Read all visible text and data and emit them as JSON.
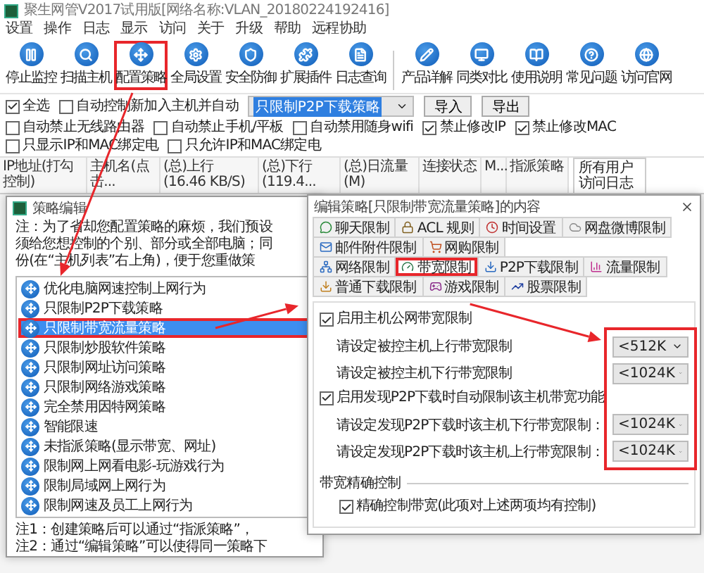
{
  "window": {
    "title": "聚生网管V2017试用版[网络名称:VLAN_20180224192416]"
  },
  "menu": [
    "设置",
    "操作",
    "日志",
    "显示",
    "访问",
    "关于",
    "升级",
    "帮助",
    "远程协助"
  ],
  "toolbar_groups": [
    {
      "buttons": [
        {
          "label": "停止监控",
          "highlighted": false
        },
        {
          "label": "扫描主机",
          "highlighted": false
        },
        {
          "label": "配置策略",
          "highlighted": true
        },
        {
          "label": "全局设置",
          "highlighted": false
        },
        {
          "label": "安全防御",
          "highlighted": false
        },
        {
          "label": "扩展插件",
          "highlighted": false
        },
        {
          "label": "日志查询",
          "highlighted": false
        }
      ]
    },
    {
      "buttons": [
        {
          "label": "产品详解",
          "highlighted": false
        },
        {
          "label": "同类对比",
          "highlighted": false
        },
        {
          "label": "使用说明",
          "highlighted": false
        },
        {
          "label": "常见问题",
          "highlighted": false
        },
        {
          "label": "访问官网",
          "highlighted": false
        }
      ]
    }
  ],
  "options": {
    "select_all": {
      "label": "全选",
      "checked": true
    },
    "auto_control": {
      "label": "自动控制新加入主机并自动",
      "checked": false
    },
    "strategy_select": {
      "value": "只限制P2P下载策略"
    },
    "buttons": [
      "导入",
      "导出"
    ]
  },
  "restrictions": [
    {
      "label": "自动禁止无线路由器",
      "checked": false
    },
    {
      "label": "自动禁止手机/平板",
      "checked": false
    },
    {
      "label": "自动禁用随身wifi",
      "checked": false
    },
    {
      "label": "禁止修改IP",
      "checked": true
    },
    {
      "label": "禁止修改MAC",
      "checked": true
    },
    {
      "label": "只显示IP和MAC绑定电",
      "checked": false
    },
    {
      "label": "只允许IP和MAC绑定电",
      "checked": false
    }
  ],
  "table": {
    "columns": [
      "IP地址(打勾控制)",
      "主机名(点击...",
      "(总)上行(16.46 KB/S)",
      "(总)下行(119.4...",
      "(总)日流量(M)",
      "连接状态",
      "M...",
      "指派策略"
    ],
    "tabs": [
      {
        "label": "所有用户访问日志",
        "selected": true
      }
    ]
  },
  "strategy_editor": {
    "title": "策略编辑",
    "notes": [
      "注：为了省却您配置策略的麻烦，我们预设",
      "须给您想控制的个别、部分或全部电脑；同",
      "份(在“主机列表”右上角)，便于您重做策"
    ],
    "strategies": [
      {
        "label": "优化电脑网速控制上网行为",
        "selected": false,
        "highlighted": false
      },
      {
        "label": "只限制P2P下载策略",
        "selected": false,
        "highlighted": false
      },
      {
        "label": "只限制带宽流量策略",
        "selected": true,
        "highlighted": true
      },
      {
        "label": "只限制炒股软件策略",
        "selected": false,
        "highlighted": false
      },
      {
        "label": "只限制网址访问策略",
        "selected": false,
        "highlighted": false
      },
      {
        "label": "只限制网络游戏策略",
        "selected": false,
        "highlighted": false
      },
      {
        "label": "完全禁用因特网策略",
        "selected": false,
        "highlighted": false
      },
      {
        "label": "智能限速",
        "selected": false,
        "highlighted": false
      },
      {
        "label": "未指派策略(显示带宽、网址)",
        "selected": false,
        "highlighted": false
      },
      {
        "label": "限制网上网看电影-玩游戏行为",
        "selected": false,
        "highlighted": false
      },
      {
        "label": "限制局域网上网行为",
        "selected": false,
        "highlighted": false
      },
      {
        "label": "限制网速及员工上网行为",
        "selected": false,
        "highlighted": false
      }
    ],
    "footnotes": [
      "注1：创建策略后可以通过“指派策略”，",
      "注2：通过“编辑策略”可以使得同一策略下"
    ]
  },
  "content_editor": {
    "title": "编辑策略[只限制带宽流量策略]的内容",
    "tab_rows": [
      [
        {
          "label": "聊天限制",
          "selected": false,
          "highlighted": false
        },
        {
          "label": "ACL 规则",
          "selected": false,
          "highlighted": false
        },
        {
          "label": "时间设置",
          "selected": false,
          "highlighted": false
        },
        {
          "label": "网盘微博限制",
          "selected": false,
          "highlighted": false
        },
        {
          "label": "邮件附件限制",
          "selected": false,
          "highlighted": false
        },
        {
          "label": "网购限制",
          "selected": false,
          "highlighted": false
        }
      ],
      [
        {
          "label": "网络限制",
          "selected": false,
          "highlighted": false
        },
        {
          "label": "带宽限制",
          "selected": true,
          "highlighted": true
        },
        {
          "label": "P2P下载限制",
          "selected": false,
          "highlighted": false
        },
        {
          "label": "流量限制",
          "selected": false,
          "highlighted": false
        },
        {
          "label": "普通下载限制",
          "selected": false,
          "highlighted": false
        },
        {
          "label": "游戏限制",
          "selected": false,
          "highlighted": false
        },
        {
          "label": "股票限制",
          "selected": false,
          "highlighted": false
        }
      ]
    ],
    "settings": [
      {
        "kind": "checkbox",
        "label": "启用主机公网带宽限制",
        "checked": true
      },
      {
        "kind": "select",
        "label": "请设定被控主机上行带宽限制",
        "value": "<512K"
      },
      {
        "kind": "select",
        "label": "请设定被控主机下行带宽限制",
        "value": "<1024K"
      },
      {
        "kind": "checkbox",
        "label": "启用发现P2P下载时自动限制该主机带宽功能",
        "checked": true
      },
      {
        "kind": "select",
        "label": "请设定发现P2P下载时该主机下行带宽限制：",
        "value": "<1024K"
      },
      {
        "kind": "select",
        "label": "请设定发现P2P下载时该主机上行带宽限制：",
        "value": "<1024K"
      },
      {
        "kind": "group",
        "label": "带宽精确控制",
        "children": [
          {
            "kind": "checkbox",
            "label": "精确控制带宽(此项对上述两项均有控制)",
            "checked": true
          }
        ]
      }
    ]
  }
}
